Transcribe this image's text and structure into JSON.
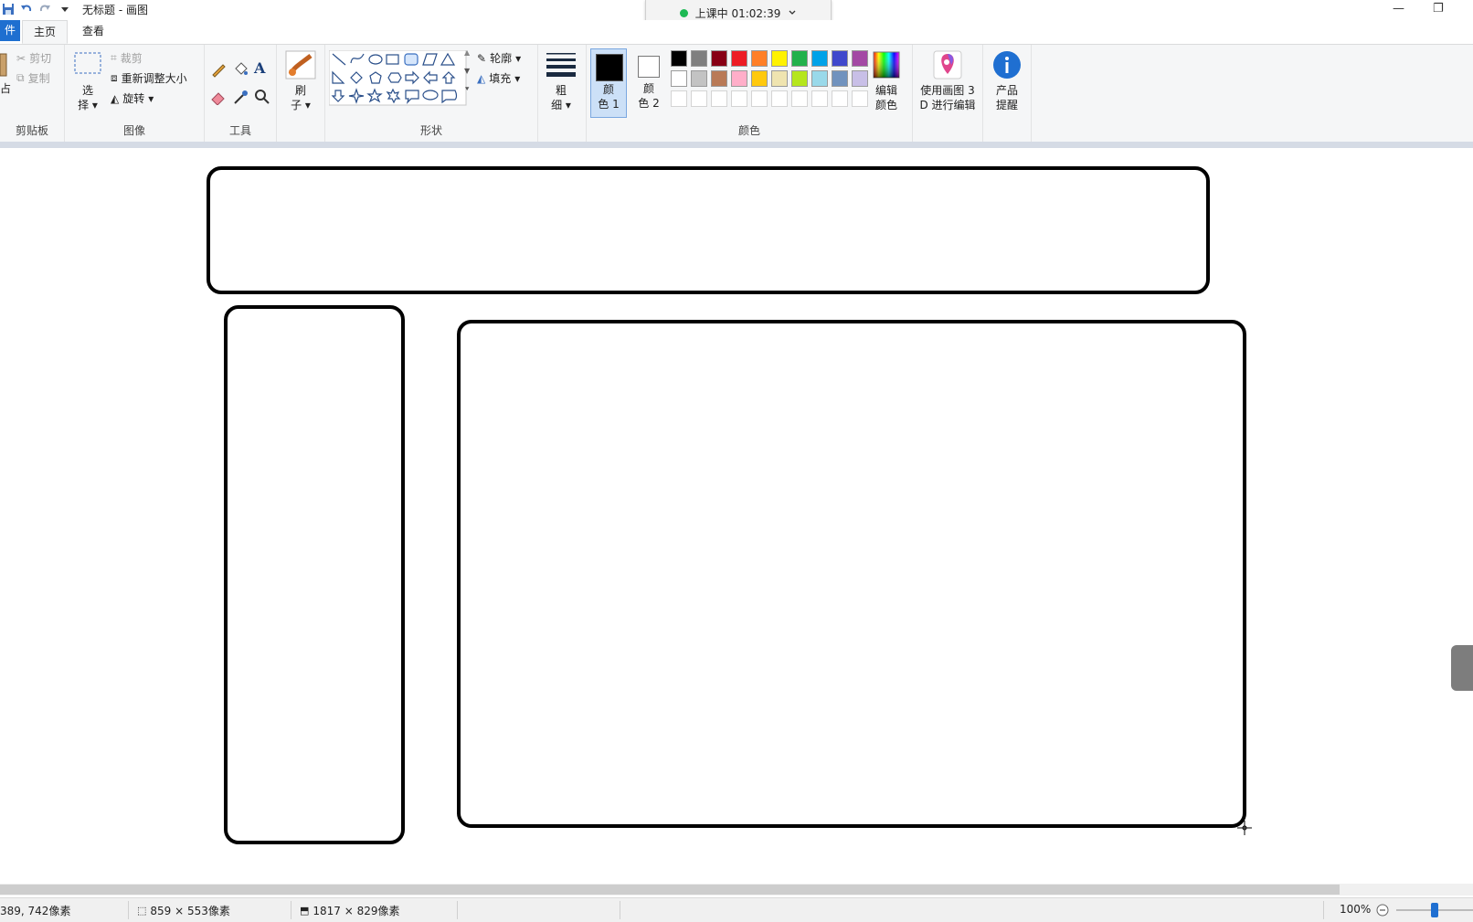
{
  "window": {
    "title": "无标题 - 画图",
    "minimize_icon": "minimize-icon",
    "restore_icon": "restore-icon"
  },
  "timer": {
    "label": "上课中 01:02:39",
    "status_color": "#1db954"
  },
  "tabs": {
    "file": "件",
    "home": "主页",
    "view": "查看"
  },
  "clipboard": {
    "paste_partial": "占",
    "cut": "剪切",
    "copy": "复制",
    "group_label": "剪贴板"
  },
  "image": {
    "select_line1": "选",
    "select_line2": "择",
    "crop": "裁剪",
    "resize": "重新调整大小",
    "rotate": "旋转",
    "group_label": "图像"
  },
  "tools": {
    "group_label": "工具"
  },
  "brushes": {
    "line1": "刷",
    "line2": "子"
  },
  "shapes": {
    "outline": "轮廓",
    "fill": "填充",
    "group_label": "形状"
  },
  "size": {
    "line1": "粗",
    "line2": "细"
  },
  "colors": {
    "color1_line1": "颜",
    "color1_line2": "色 1",
    "color2_line1": "颜",
    "color2_line2": "色 2",
    "edit_line1": "编辑",
    "edit_line2": "颜色",
    "group_label": "颜色",
    "color1_value": "#000000",
    "color2_value": "#ffffff",
    "palette_row1": [
      "#000000",
      "#7f7f7f",
      "#880015",
      "#ed1c24",
      "#ff7f27",
      "#fff200",
      "#22b14c",
      "#00a2e8",
      "#3f48cc",
      "#a349a4"
    ],
    "palette_row2": [
      "#ffffff",
      "#c3c3c3",
      "#b97a57",
      "#ffaec9",
      "#ffc90e",
      "#efe4b0",
      "#b5e61d",
      "#99d9ea",
      "#7092be",
      "#c8bfe7"
    ]
  },
  "paint3d": {
    "line1": "使用画图 3",
    "line2": "D 进行编辑"
  },
  "product": {
    "line1": "产品",
    "line2": "提醒"
  },
  "status": {
    "cursor_pos": "389, 742像素",
    "selection_size": "859 × 553像素",
    "image_size": "1817 × 829像素",
    "zoom": "100%",
    "zoom_fraction": 0.5
  }
}
